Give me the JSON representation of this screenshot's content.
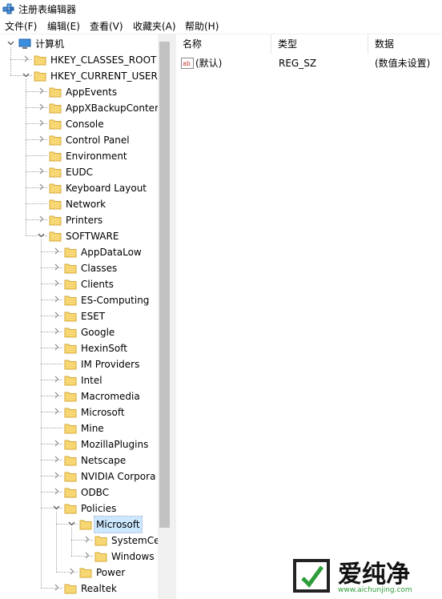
{
  "window": {
    "title": "注册表编辑器"
  },
  "menu": [
    "文件(F)",
    "编辑(E)",
    "查看(V)",
    "收藏夹(A)",
    "帮助(H)"
  ],
  "tree": {
    "root": "计算机",
    "hive1": "HKEY_CLASSES_ROOT",
    "hive2": "HKEY_CURRENT_USER",
    "hkcu_children": [
      "AppEvents",
      "AppXBackupConter",
      "Console",
      "Control Panel",
      "Environment",
      "EUDC",
      "Keyboard Layout",
      "Network",
      "Printers",
      "SOFTWARE"
    ],
    "software_children": [
      "AppDataLow",
      "Classes",
      "Clients",
      "ES-Computing",
      "ESET",
      "Google",
      "HexinSoft",
      "IM Providers",
      "Intel",
      "Macromedia",
      "Microsoft",
      "Mine",
      "MozillaPlugins",
      "Netscape",
      "NVIDIA Corpora",
      "ODBC",
      "Policies"
    ],
    "policies_children": [
      "Microsoft",
      "Power"
    ],
    "microsoft_children": [
      "SystemCe",
      "Windows"
    ],
    "after": "Realtek"
  },
  "list": {
    "columns": [
      "名称",
      "类型",
      "数据"
    ],
    "rows": [
      {
        "name": "(默认)",
        "type": "REG_SZ",
        "data": "(数值未设置)"
      }
    ]
  },
  "watermark": {
    "brand": "爱纯净",
    "url": "www.aichunjing.com"
  }
}
